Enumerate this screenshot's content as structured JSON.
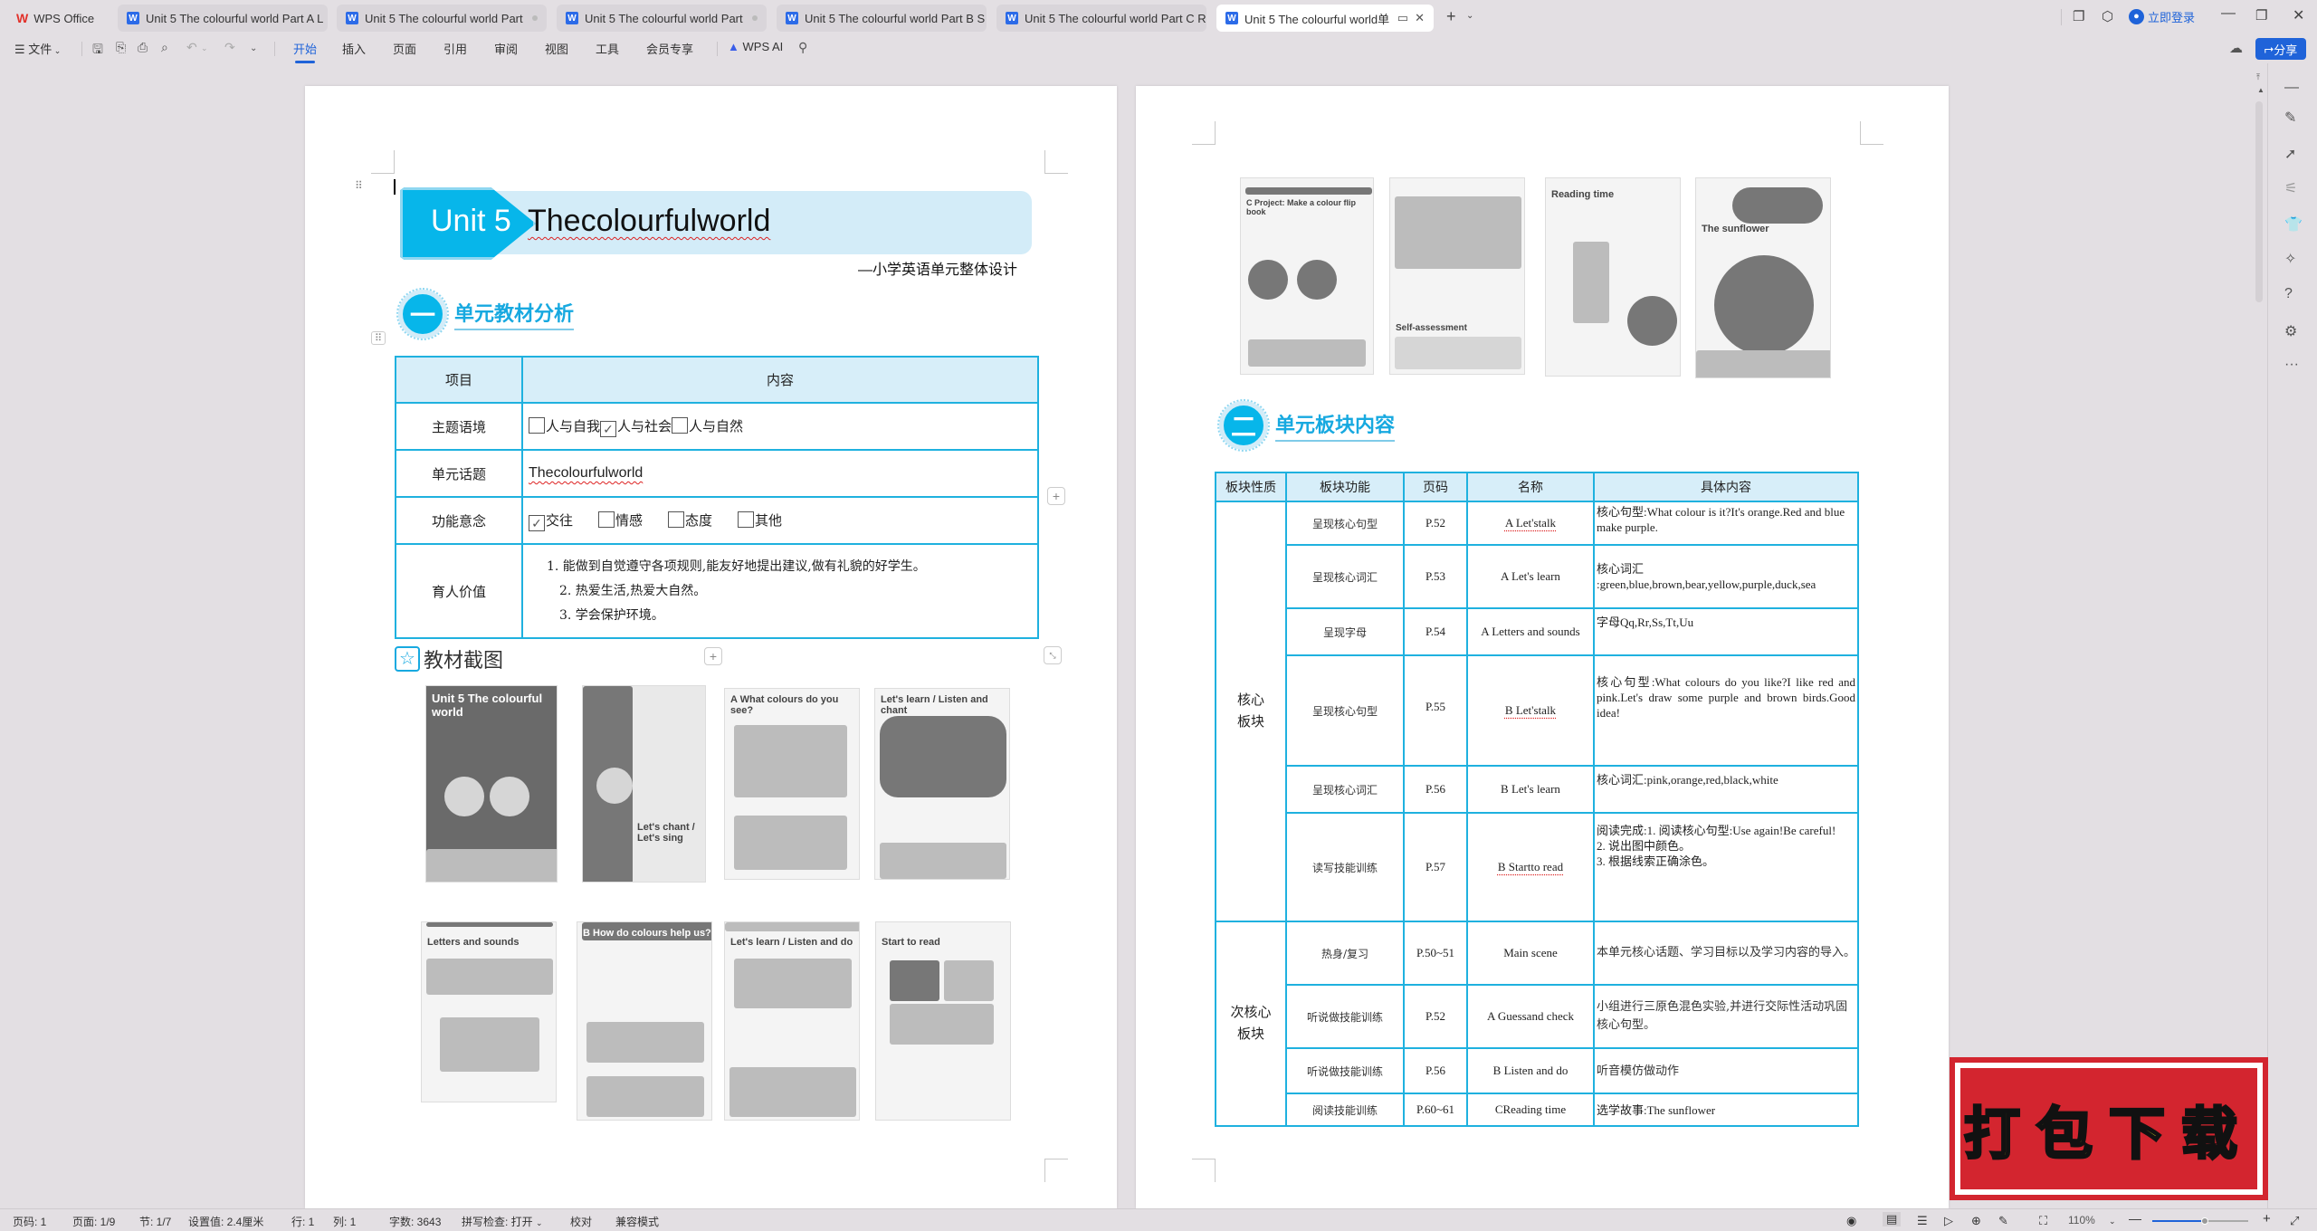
{
  "tabs": [
    {
      "label": "WPS Office",
      "type": "home"
    },
    {
      "label": "Unit 5 The colourful world Part A L",
      "type": "doc"
    },
    {
      "label": "Unit 5 The colourful world Part",
      "type": "doc"
    },
    {
      "label": "Unit 5 The colourful world Part",
      "type": "doc"
    },
    {
      "label": "Unit 5 The colourful world Part B S",
      "type": "doc"
    },
    {
      "label": "Unit 5 The colourful world Part C R",
      "type": "doc"
    },
    {
      "label": "Unit 5 The colourful world单",
      "type": "doc",
      "active": true
    }
  ],
  "window": {
    "login_label": "立即登录",
    "share_label": "分享"
  },
  "ribbon": {
    "file_menu": "文件",
    "menus": [
      "开始",
      "插入",
      "页面",
      "引用",
      "审阅",
      "视图",
      "工具",
      "会员专享"
    ],
    "active_menu": "开始",
    "ai_label": "WPS AI"
  },
  "page1": {
    "banner_unit": "Unit 5",
    "banner_title": "Thecolourfulworld",
    "subtitle": "—小学英语单元整体设计",
    "section1": {
      "number": "一",
      "title": "单元教材分析"
    },
    "table": {
      "headers": [
        "项目",
        "内容"
      ],
      "rows": {
        "theme": {
          "label": "主题语境",
          "options": [
            {
              "text": "人与自我",
              "checked": false
            },
            {
              "text": "人与社会",
              "checked": true
            },
            {
              "text": "人与自然",
              "checked": false
            }
          ]
        },
        "topic": {
          "label": "单元话题",
          "value": "Thecolourfulworld"
        },
        "function": {
          "label": "功能意念",
          "options": [
            {
              "text": "交往",
              "checked": true
            },
            {
              "text": "情感",
              "checked": false
            },
            {
              "text": "态度",
              "checked": false
            },
            {
              "text": "其他",
              "checked": false
            }
          ]
        },
        "values": {
          "label": "育人价值",
          "items": [
            "1. 能做到自觉遵守各项规则,能友好地提出建议,做有礼貌的好学生。",
            "2. 热爱生活,热爱大自然。",
            "3. 学会保护环境。"
          ]
        }
      }
    },
    "gallery_title": "教材截图",
    "thumbnails_row1": [
      "Unit 5 The colourful world",
      "Let's chant / Let's sing",
      "A What colours do you see?",
      "Let's learn / Listen and chant"
    ],
    "thumbnails_row2": [
      "Letters and sounds",
      "B How do colours help us?",
      "Let's learn / Listen and do",
      "Start to read"
    ]
  },
  "page2": {
    "thumbnails": [
      "C Project: Make a colour flip book",
      "Self-assessment",
      "Reading time",
      "The sunflower"
    ],
    "section2": {
      "number": "二",
      "title": "单元板块内容"
    },
    "table": {
      "headers": [
        "板块性质",
        "板块功能",
        "页码",
        "名称",
        "具体内容"
      ],
      "groups": [
        {
          "nature": "核心板块",
          "rows": [
            {
              "function": "呈现核心句型",
              "page": "P.52",
              "name": "A Let'stalk",
              "content": "核心句型:What colour is it?It's orange.Red and blue make purple."
            },
            {
              "function": "呈现核心词汇",
              "page": "P.53",
              "name": "A Let's learn",
              "content": "核心词汇 :green,blue,brown,bear,yellow,purple,duck,sea"
            },
            {
              "function": "呈现字母",
              "page": "P.54",
              "name": "A Letters and sounds",
              "content": "字母Qq,Rr,Ss,Tt,Uu"
            },
            {
              "function": "呈现核心句型",
              "page": "P.55",
              "name": "B Let'stalk",
              "content": "核心句型:What colours do you like?I like red and pink.Let's draw some purple and brown birds.Good idea!"
            },
            {
              "function": "呈现核心词汇",
              "page": "P.56",
              "name": "B Let's learn",
              "content": "核心词汇:pink,orange,red,black,white"
            },
            {
              "function": "读写技能训练",
              "page": "P.57",
              "name": "B Startto read",
              "content": "阅读完成:1. 阅读核心句型:Use again!Be careful!\n2. 说出图中颜色。\n3. 根据线索正确涂色。"
            }
          ]
        },
        {
          "nature": "次核心板块",
          "rows": [
            {
              "function": "热身/复习",
              "page": "P.50~51",
              "name": "Main scene",
              "content": "本单元核心话题、学习目标以及学习内容的导入。"
            },
            {
              "function": "听说做技能训练",
              "page": "P.52",
              "name": "A Guessand check",
              "content": "小组进行三原色混色实验,并进行交际性活动巩固核心句型。"
            },
            {
              "function": "听说做技能训练",
              "page": "P.56",
              "name": "B Listen and do",
              "content": "听音模仿做动作"
            },
            {
              "function": "阅读技能训练",
              "page": "P.60~61",
              "name": "CReading time",
              "content": "选学故事:The sunflower"
            }
          ]
        }
      ]
    }
  },
  "status": {
    "page_num": "页码: 1",
    "pages": "页面: 1/9",
    "section": "节: 1/7",
    "setting": "设置值: 2.4厘米",
    "row": "行: 1",
    "col": "列: 1",
    "word_count": "字数: 3643",
    "spell_check": "拼写检查: 打开",
    "proofread": "校对",
    "compat_mode": "兼容模式",
    "zoom": "110%",
    "zoom_fraction": 0.55
  },
  "overlay": {
    "stamp_text": "打包下载"
  },
  "colors": {
    "accent": "#1f63d9",
    "table_border": "#1fb1df",
    "header_fill": "#d7eef9",
    "banner": "#07b6ea",
    "stamp": "#d3252f"
  }
}
